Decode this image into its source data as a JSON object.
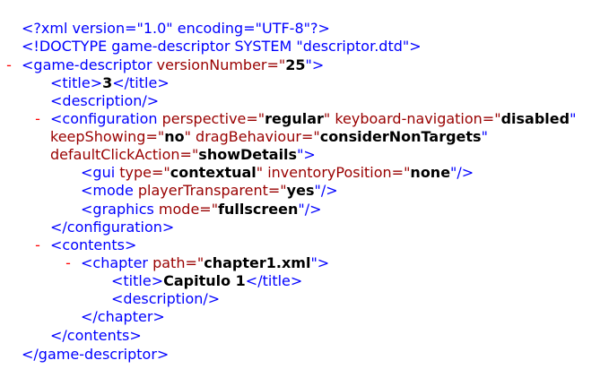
{
  "xml_lines": [
    {
      "id": "decl",
      "toggle": "",
      "text": "<?xml version=\"1.0\" encoding=\"UTF-8\"?>"
    },
    {
      "id": "doctype",
      "toggle": "",
      "text": "<!DOCTYPE game-descriptor SYSTEM \"descriptor.dtd\">"
    },
    {
      "id": "game-descriptor-open",
      "toggle": "-",
      "open": "<game-descriptor",
      "attr": " versionNumber=\"",
      "value": "25",
      "close": "\">"
    },
    {
      "id": "title-open",
      "text_pre": "<title>",
      "value": "3",
      "text_post": "</title>"
    },
    {
      "id": "description",
      "text": "<description/>"
    },
    {
      "id": "configuration-open",
      "toggle": "-",
      "open": "<configuration",
      "parts": [
        " perspective=\"",
        "regular",
        "\" keyboard-navigation=\"",
        "disabled",
        "\""
      ]
    },
    {
      "id": "configuration-cont1",
      "parts": [
        "keepShowing=\"",
        "no",
        "\" dragBehaviour=\"",
        "considerNonTargets",
        "\""
      ]
    },
    {
      "id": "configuration-cont2",
      "parts": [
        "defaultClickAction=\"",
        "showDetails",
        "\">"
      ]
    },
    {
      "id": "gui",
      "open": "<gui",
      "parts": [
        " type=\"",
        "contextual",
        "\" inventoryPosition=\"",
        "none",
        "\"/>"
      ]
    },
    {
      "id": "mode",
      "open": "<mode",
      "parts": [
        " playerTransparent=\"",
        "yes",
        "\"/>"
      ]
    },
    {
      "id": "graphics",
      "open": "<graphics",
      "parts": [
        " mode=\"",
        "fullscreen",
        "\"/>"
      ]
    },
    {
      "id": "configuration-close",
      "text": "</configuration>"
    },
    {
      "id": "contents-open",
      "toggle": "-",
      "text": "<contents>"
    },
    {
      "id": "chapter-open",
      "toggle": "-",
      "open": "<chapter",
      "parts": [
        " path=\"",
        "chapter1.xml",
        "\">"
      ]
    },
    {
      "id": "chapter-title",
      "text_pre": "<title>",
      "value": "Capitulo 1",
      "text_post": "</title>"
    },
    {
      "id": "chapter-description",
      "text": "<description/>"
    },
    {
      "id": "chapter-close",
      "text": "</chapter>"
    },
    {
      "id": "contents-close",
      "text": "</contents>"
    },
    {
      "id": "game-descriptor-close",
      "text": "</game-descriptor>"
    }
  ],
  "colors": {
    "markup": "#0000ff",
    "tag": "#990000",
    "toggle": "#ff0000",
    "value": "#000000"
  }
}
